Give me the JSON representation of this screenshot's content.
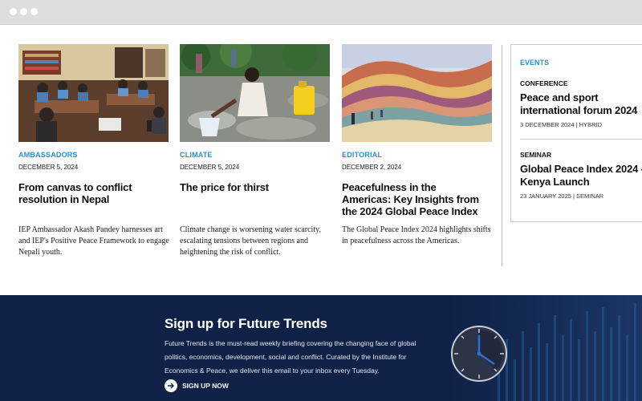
{
  "window": {
    "controls": [
      "window-dot",
      "window-dot",
      "window-dot"
    ]
  },
  "articles": [
    {
      "category": "AMBASSADORS",
      "date": "DECEMBER 5, 2024",
      "title": "From canvas to conflict resolution in Nepal",
      "description": "IEP Ambassador Akash Pandey harnesses art and IEP's Positive Peace Framework to engage Nepali youth."
    },
    {
      "category": "CLIMATE",
      "date": "DECEMBER 5, 2024",
      "title": "The price for thirst",
      "description": "Climate change is worsening water scarcity, escalating tensions between regions and heightening the risk of conflict."
    },
    {
      "category": "EDITORIAL",
      "date": "DECEMBER 2, 2024",
      "title": "Peacefulness in the Americas: Key Insights from the 2024 Global Peace Index",
      "description": "The Global Peace Index 2024 highlights shifts in peacefulness across the Americas."
    }
  ],
  "events": {
    "heading": "EVENTS",
    "items": [
      {
        "type": "CONFERENCE",
        "title": "Peace and sport international forum 2024",
        "meta": "3 DECEMBER 2024 | HYBRID"
      },
      {
        "type": "SEMINAR",
        "title": "Global Peace Index 2024 - Kenya Launch",
        "meta": "23 JANUARY 2025 | SEMINAR"
      }
    ]
  },
  "signup": {
    "title": "Sign up for Future Trends",
    "text": "Future Trends is the must-read weekly briefing covering the changing face of global politics, economics, development, social and conflict. Curated by the Institute for Economics & Peace, we deliver this email to your inbox every Tuesday.",
    "button_label": "SIGN UP NOW",
    "button_icon": "arrow-right-icon",
    "decor_icon": "clock-icon"
  },
  "colors": {
    "accent": "#2b8fd0",
    "banner": "#0f2146"
  }
}
